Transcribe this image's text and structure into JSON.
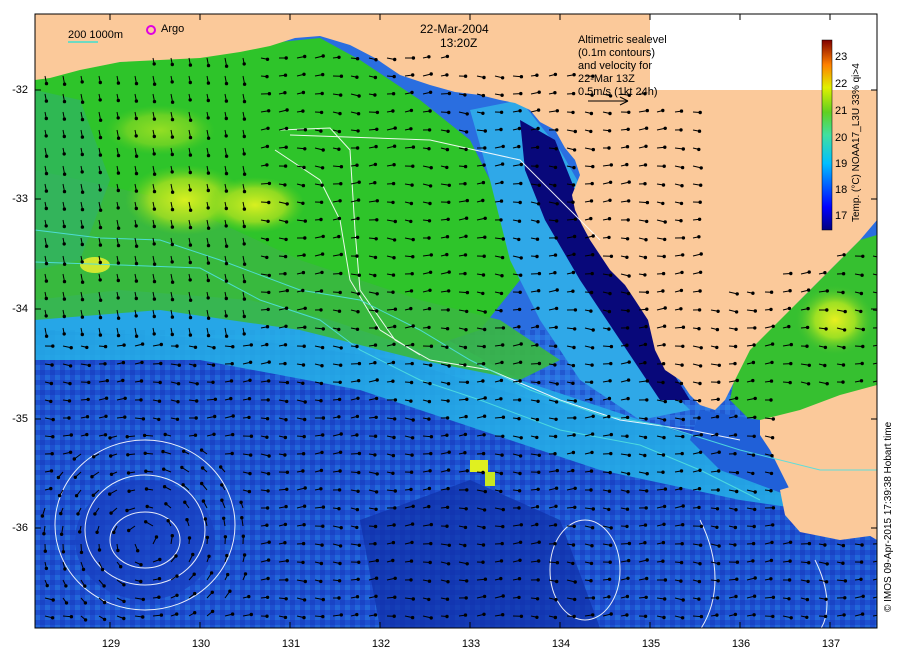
{
  "header": {
    "date": "22-Mar-2004",
    "time": "13:20Z"
  },
  "legend": {
    "contours_label": "200  1000m",
    "argo_label": "Argo",
    "argo_color": "#e000e0",
    "contour_color": "#40e0d0"
  },
  "annotation": {
    "lines": [
      "Altimetric sealevel",
      "(0.1m contours)",
      "and velocity for",
      "22-Mar 13Z",
      "0.5m/s (1kt 24h)"
    ]
  },
  "colorbar": {
    "title": "Temp. (°C) NOAA17_L3U 33% qi>4",
    "ticks": [
      "23",
      "22",
      "21",
      "20",
      "19",
      "18",
      "17"
    ],
    "min": 16.5,
    "max": 23.5
  },
  "axes": {
    "y_ticks": [
      "-32",
      "-33",
      "-34",
      "-35",
      "-36"
    ],
    "x_ticks": [
      "129",
      "130",
      "131",
      "132",
      "133",
      "134",
      "135",
      "136",
      "137"
    ]
  },
  "credit": "© IMOS 09-Apr-2015 17:39:38 Hobart time",
  "colors": {
    "land": "#fbc99a",
    "deep_blue": "#08087a",
    "blue": "#1a4fd8",
    "cyan": "#22b8e8",
    "green": "#20c020",
    "yellow_green": "#a8e020",
    "yellow": "#f0f020"
  }
}
